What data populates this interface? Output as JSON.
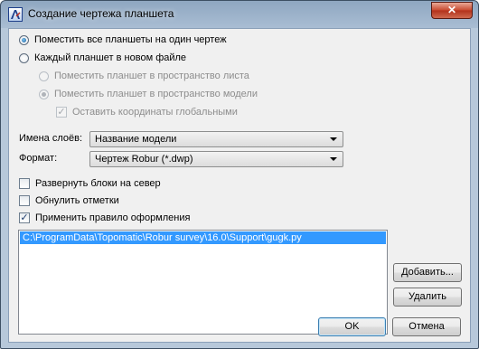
{
  "window": {
    "title": "Создание чертежа  планшета",
    "close_symbol": "✕",
    "app_icon": "autocad-app-icon"
  },
  "options": {
    "single_drawing": {
      "label": "Поместить все планшеты на один чертеж",
      "checked": true
    },
    "each_new_file": {
      "label": "Каждый планшет в новом файле",
      "checked": false
    },
    "sub": {
      "paper_space": {
        "label": "Поместить планшет в пространство листа",
        "checked": false,
        "enabled": false
      },
      "model_space": {
        "label": "Поместить планшет в пространство модели",
        "checked": true,
        "enabled": false
      },
      "keep_global": {
        "label": "Оставить координаты глобальными",
        "checked": true,
        "enabled": false
      }
    }
  },
  "layer_names": {
    "label": "Имена слоёв:",
    "value": "Название модели"
  },
  "format": {
    "label": "Формат:",
    "value": "Чертеж Robur (*.dwp)"
  },
  "checkboxes": {
    "rotate_blocks": {
      "label": "Развернуть блоки на север",
      "checked": false
    },
    "reset_marks": {
      "label": "Обнулить отметки",
      "checked": false
    },
    "apply_style": {
      "label": "Применить правило оформления",
      "checked": true
    }
  },
  "style_files": [
    "C:\\ProgramData\\Topomatic\\Robur survey\\16.0\\Support\\gugk.py"
  ],
  "buttons": {
    "add": "Добавить...",
    "remove": "Удалить",
    "ok": "OK",
    "cancel": "Отмена"
  },
  "colors": {
    "selection": "#3399ff",
    "close_button": "#c8482e",
    "dialog_face": "#f0f0f0"
  }
}
